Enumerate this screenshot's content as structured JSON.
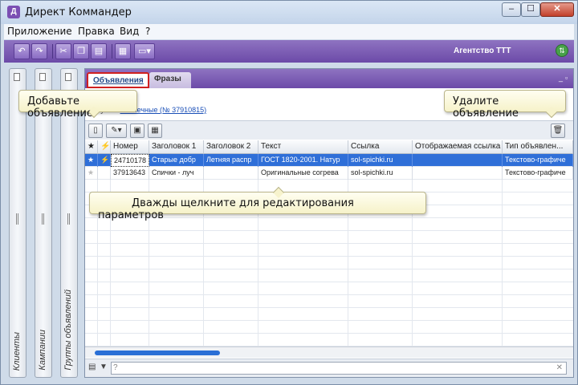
{
  "window": {
    "title": "Директ Коммандер",
    "min": "–",
    "max": "☐",
    "close": "✕"
  },
  "menu": [
    "Приложение",
    "Правка",
    "Вид",
    "?"
  ],
  "toolbar": {
    "agency": "Агентство ТТТ"
  },
  "side_panels": [
    "Клиенты",
    "Кампании",
    "Группы объявлений"
  ],
  "tabs": {
    "active": "Объявления",
    "inactive": "Фразы"
  },
  "breadcrumb": {
    "prefix": "Группа: ",
    "link": "Спичечные (№ 37910815)"
  },
  "columns": [
    "Номер",
    "Заголовок 1",
    "Заголовок 2",
    "Текст",
    "Ссылка",
    "Отображаемая ссылка",
    "Тип объявлен..."
  ],
  "rows": [
    {
      "number": "24710178",
      "title1": "Старые добр",
      "title2": "Летняя распр",
      "text": "ГОСТ 1820-2001. Натур",
      "link": "sol-spichki.ru",
      "display_link": "",
      "type": "Текстово-графиче",
      "selected": true
    },
    {
      "number": "37913643",
      "title1": "Спички - луч",
      "title2": "",
      "text": "Оригинальные согрева",
      "link": "sol-spichki.ru",
      "display_link": "",
      "type": "Текстово-графиче",
      "selected": false
    }
  ],
  "tooltips": {
    "add": "Добавьте объявление",
    "delete": "Удалите объявление",
    "edit": "Дважды щелкните для редактирования параметров"
  },
  "colors": {
    "accent": "#6c4aa8",
    "selection": "#2f6fd8",
    "tab_highlight": "#d02020"
  }
}
